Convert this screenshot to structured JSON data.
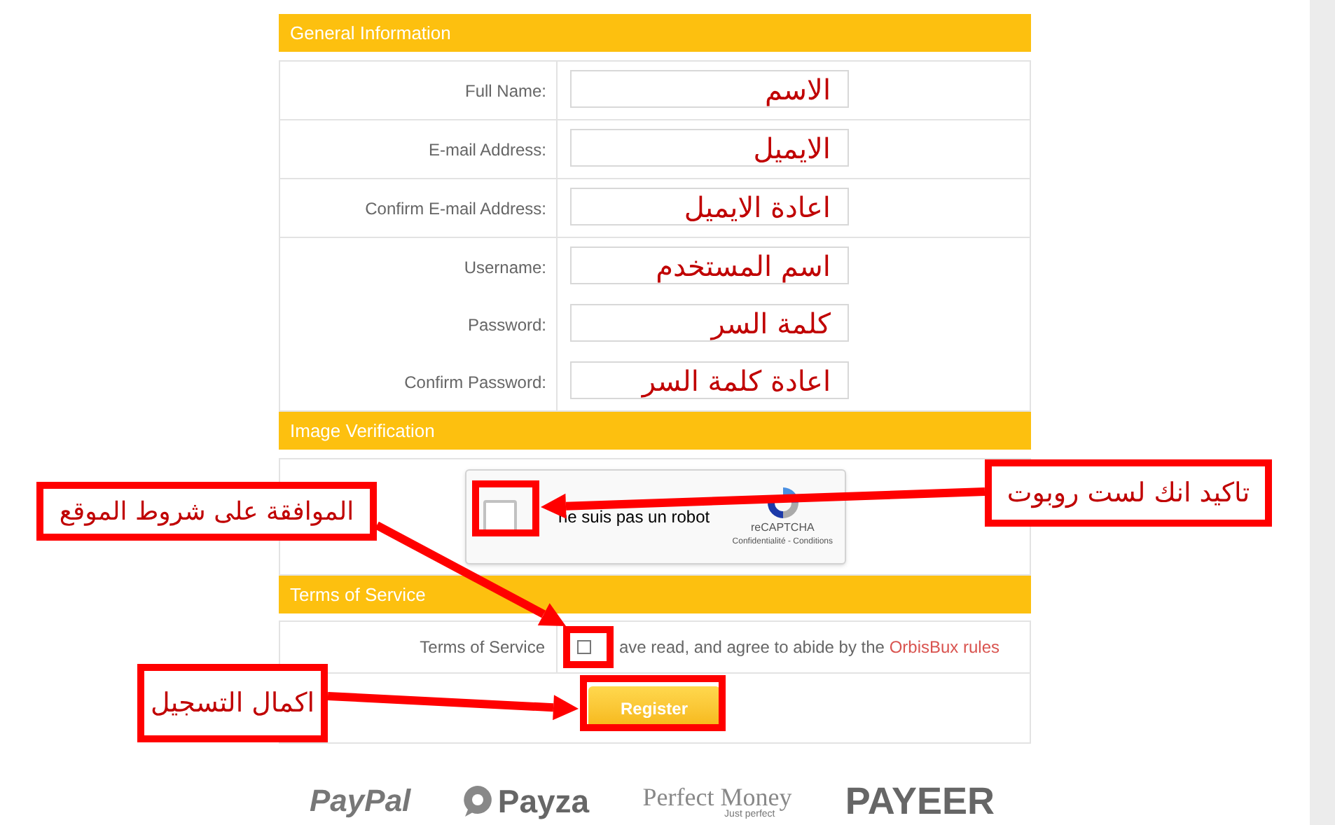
{
  "general_information": {
    "title": "General Information",
    "rows": [
      {
        "fields": [
          {
            "label": "Full Name:",
            "value": "الاسم"
          }
        ]
      },
      {
        "fields": [
          {
            "label": "E-mail Address:",
            "value": "الايميل"
          }
        ]
      },
      {
        "fields": [
          {
            "label": "Confirm E-mail Address:",
            "value": "اعادة الايميل"
          }
        ]
      },
      {
        "fields": [
          {
            "label": "Username:",
            "value": "اسم المستخدم"
          },
          {
            "label": "Password:",
            "value": "كلمة السر"
          },
          {
            "label": "Confirm Password:",
            "value": "اعادة كلمة السر"
          }
        ]
      }
    ]
  },
  "image_verification": {
    "title": "Image Verification",
    "captcha": {
      "checked": false,
      "label": "ne suis pas un robot",
      "brand": "reCAPTCHA",
      "links": "Confidentialité - Conditions"
    }
  },
  "terms_of_service": {
    "title": "Terms of Service",
    "label": "Terms of Service",
    "checked": false,
    "text": "ave read, and agree to abide by the",
    "link": "OrbisBux rules",
    "button": "Register"
  },
  "payment_logos": [
    {
      "kind": "paypal",
      "text": "PayPal"
    },
    {
      "kind": "payza",
      "text": "Payza"
    },
    {
      "kind": "perfect",
      "text": "Perfect Money",
      "sub": "Just perfect"
    },
    {
      "kind": "payeer",
      "text": "PAYEER"
    }
  ],
  "annotations": [
    "تاكيد انك لست روبوت",
    "الموافقة على شروط الموقع",
    "اكمال التسجيل"
  ]
}
